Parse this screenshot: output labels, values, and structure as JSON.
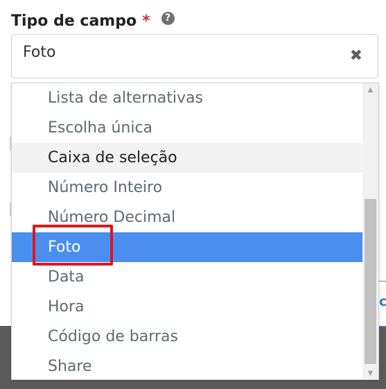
{
  "field": {
    "label": "Tipo de campo",
    "required_mark": "*",
    "help_icon": "question-circle-icon",
    "value": "Foto",
    "clear_icon": "close-icon",
    "clear_glyph": "✖"
  },
  "dropdown": {
    "options": [
      {
        "label": "Lista de alternativas",
        "state": "normal"
      },
      {
        "label": "Escolha única",
        "state": "normal"
      },
      {
        "label": "Caixa de seleção",
        "state": "hover"
      },
      {
        "label": "Número Inteiro",
        "state": "normal"
      },
      {
        "label": "Número Decimal",
        "state": "normal"
      },
      {
        "label": "Foto",
        "state": "selected"
      },
      {
        "label": "Data",
        "state": "normal"
      },
      {
        "label": "Hora",
        "state": "normal"
      },
      {
        "label": "Código de barras",
        "state": "normal"
      },
      {
        "label": "Share",
        "state": "normal"
      }
    ],
    "selected_color": "#4a8ff0",
    "hover_color": "#f2f2f2"
  },
  "annotation": {
    "highlight_color": "#e4141b",
    "highlight_target": "Foto"
  },
  "background": {
    "partial_char": "c"
  }
}
